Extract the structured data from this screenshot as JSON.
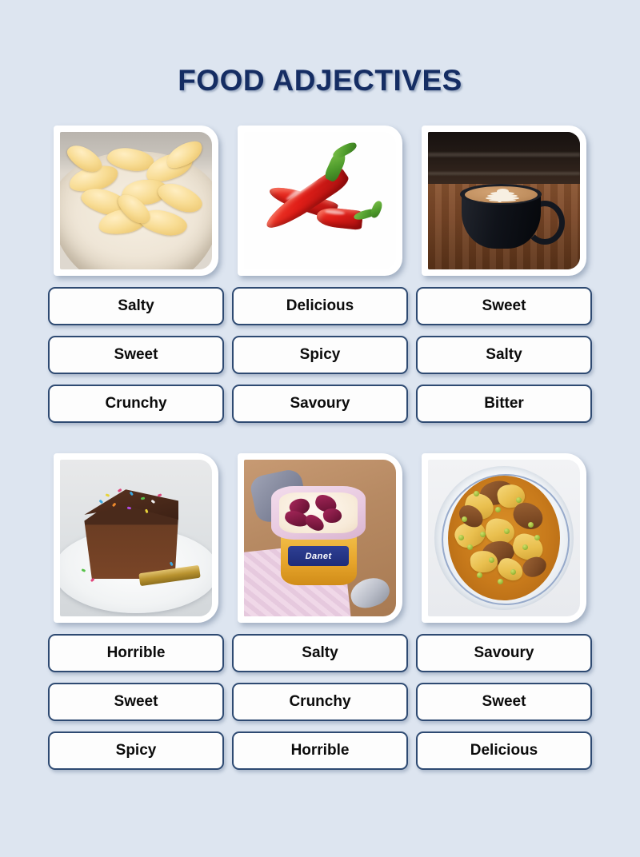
{
  "page": {
    "title": "FOOD ADJECTIVES",
    "background_color": "#dde5f0",
    "title_color": "#152d63",
    "button_border_color": "#2e4a72",
    "button_fill_color": "#fdfdfd",
    "button_text_color": "#0b0b0b"
  },
  "items": [
    {
      "image_name": "bowl-of-potato-chips",
      "options": [
        "Salty",
        "Sweet",
        "Crunchy"
      ]
    },
    {
      "image_name": "red-chili-peppers",
      "options": [
        "Delicious",
        "Spicy",
        "Savoury"
      ]
    },
    {
      "image_name": "cup-of-latte-coffee",
      "options": [
        "Sweet",
        "Salty",
        "Bitter"
      ]
    },
    {
      "image_name": "chocolate-cake-slice",
      "options": [
        "Horrible",
        "Sweet",
        "Spicy"
      ]
    },
    {
      "image_name": "danet-yogurt-cup",
      "options": [
        "Salty",
        "Crunchy",
        "Horrible"
      ]
    },
    {
      "image_name": "meat-and-potato-stew",
      "options": [
        "Savoury",
        "Sweet",
        "Delicious"
      ]
    }
  ],
  "labels": {
    "yogurt_brand": "Danet"
  }
}
